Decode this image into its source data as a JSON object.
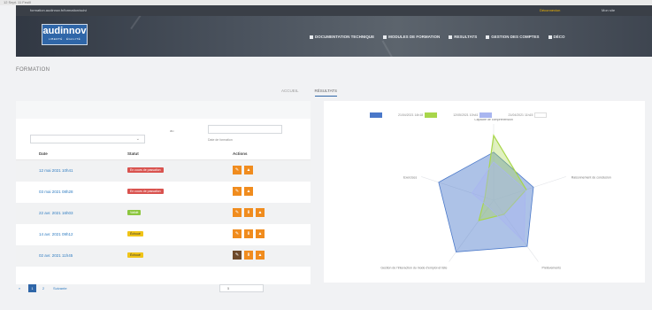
{
  "browser": {
    "top_left": "12 Sept. 11 Feuill",
    "url": "formation.audinnov.fr/formation/suivi",
    "warning": "Déconnexion",
    "user": "Mon site"
  },
  "brand": {
    "name": "audinnov",
    "tagline": "LIBERTÉ · ÉGALITÉ"
  },
  "nav": [
    "DOCUMENTATION TECHNIQUE",
    "MODULES DE FORMATION",
    "RESULTATS",
    "GESTION DES COMPTES",
    "DÉCO"
  ],
  "page": {
    "title": "FORMATION"
  },
  "tabs": [
    {
      "label": "ACCUEIL",
      "active": false
    },
    {
      "label": "RÉSULTATS",
      "active": true
    }
  ],
  "filters": {
    "separator": "au",
    "select_arrow": "⌄",
    "date_label": "Date de formation"
  },
  "table": {
    "headers": [
      "Date",
      "Statut",
      "Actions"
    ],
    "rows": [
      {
        "date": "12 mai 2021 10h41",
        "status": "En cours de passation",
        "status_color": "red",
        "actions": [
          "✎",
          "▲"
        ],
        "alt": true
      },
      {
        "date": "03 mai 2021 08h28",
        "status": "En cours de passation",
        "status_color": "red",
        "actions": [
          "✎",
          "▲"
        ],
        "alt": false
      },
      {
        "date": "22 avr. 2021 16h03",
        "status": "Validé",
        "status_color": "green",
        "actions": [
          "✎",
          "⬇",
          "▲"
        ],
        "alt": true
      },
      {
        "date": "14 avr. 2021 09h12",
        "status": "Échoué",
        "status_color": "yellow",
        "actions": [
          "✎",
          "⬇",
          "▲"
        ],
        "alt": false
      },
      {
        "date": "02 avr. 2021 11h45",
        "status": "Échoué",
        "status_color": "yellow",
        "actions": [
          "✎",
          "⬇",
          "▲"
        ],
        "alt": true
      }
    ]
  },
  "pagination": {
    "prev": "«",
    "current": "1",
    "next_page": "2",
    "next_label": "Suivante",
    "per_page": "5"
  },
  "legend": [
    {
      "label": "",
      "color": "#4a78c9"
    },
    {
      "label": "21/04/2021 14h18",
      "color": "#a8d64a"
    },
    {
      "label": "12/05/2021 10h41",
      "color": "#a9b6f0"
    },
    {
      "label": "21/04/2021 11h15",
      "color": "none"
    }
  ],
  "radar": {
    "axes": [
      "Capacité de compréhension",
      "Raisonnement de conclusion",
      "Prélèvements",
      "Gestion de l'interaction du mode d'emploi et liste",
      "Exercices"
    ],
    "series": [
      {
        "color": "#4a78c9",
        "values": [
          0.63,
          0.55,
          0.75,
          0.84,
          0.76
        ]
      },
      {
        "color": "#a8d64a",
        "values": [
          0.85,
          0.45,
          0.23,
          0.33,
          0.12
        ]
      },
      {
        "color": "#a9b6f0",
        "values": [
          0.5,
          0.44,
          0.68,
          0.11,
          0.3
        ]
      }
    ]
  }
}
